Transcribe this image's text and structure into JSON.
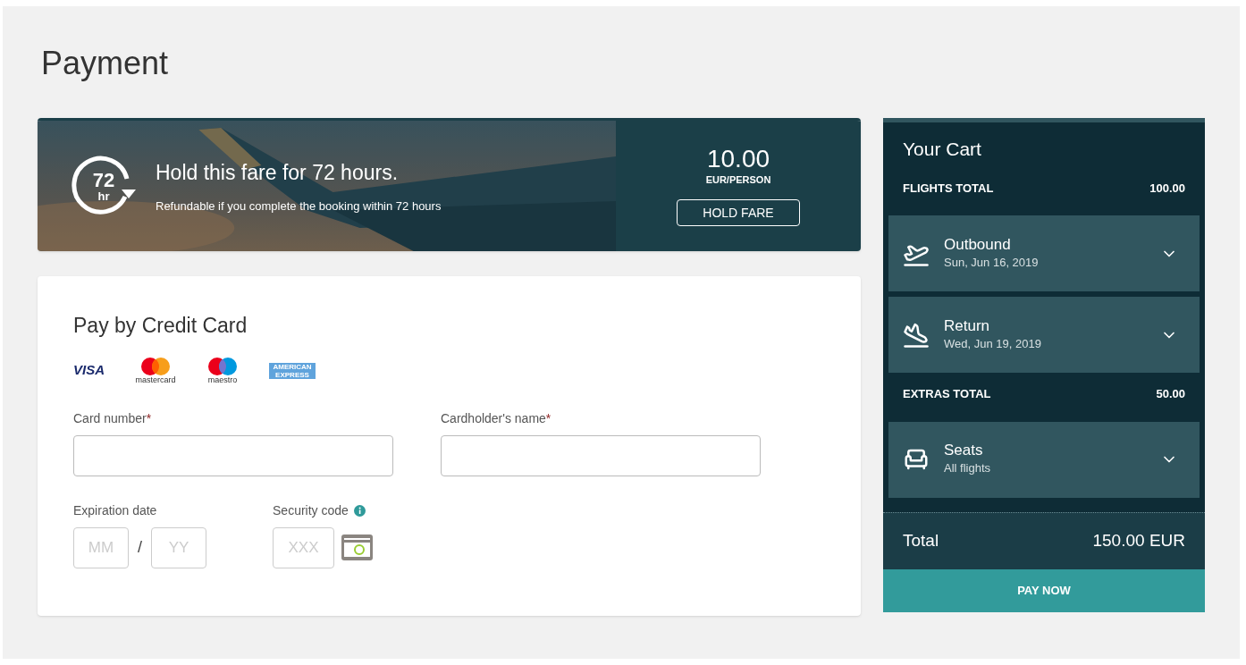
{
  "title": "Payment",
  "hold": {
    "icon_number": "72",
    "icon_unit": "hr",
    "heading": "Hold this fare for 72 hours.",
    "subtext": "Refundable if you complete the booking within 72 hours",
    "price": "10.00",
    "price_unit": "EUR/PERSON",
    "button": "HOLD FARE"
  },
  "payment": {
    "heading": "Pay by Credit Card",
    "card_brands": [
      {
        "kind": "visa",
        "label": "VISA"
      },
      {
        "kind": "mastercard",
        "label": "mastercard"
      },
      {
        "kind": "maestro",
        "label": "maestro"
      },
      {
        "kind": "amex",
        "label": "AMERICAN EXPRESS"
      }
    ],
    "card_number": {
      "label": "Card number",
      "required_mark": "*"
    },
    "cardholder": {
      "label": "Cardholder's name",
      "required_mark": "*"
    },
    "expiration": {
      "label": "Expiration date",
      "month_placeholder": "MM",
      "separator": "/",
      "year_placeholder": "YY"
    },
    "security": {
      "label": "Security code",
      "placeholder": "XXX"
    }
  },
  "cart": {
    "title": "Your Cart",
    "sections": [
      {
        "label": "FLIGHTS TOTAL",
        "amount": "100.00",
        "items": [
          {
            "kind": "departure",
            "title": "Outbound",
            "subtitle": "Sun, Jun 16, 2019",
            "expanded": false
          },
          {
            "kind": "arrival",
            "title": "Return",
            "subtitle": "Wed, Jun 19, 2019",
            "expanded": false
          }
        ]
      },
      {
        "label": "EXTRAS TOTAL",
        "amount": "50.00",
        "items": [
          {
            "kind": "seat",
            "title": "Seats",
            "subtitle": "All flights",
            "expanded": false
          }
        ]
      }
    ],
    "total_label": "Total",
    "total_amount": "150.00 EUR",
    "pay_button": "PAY NOW"
  }
}
